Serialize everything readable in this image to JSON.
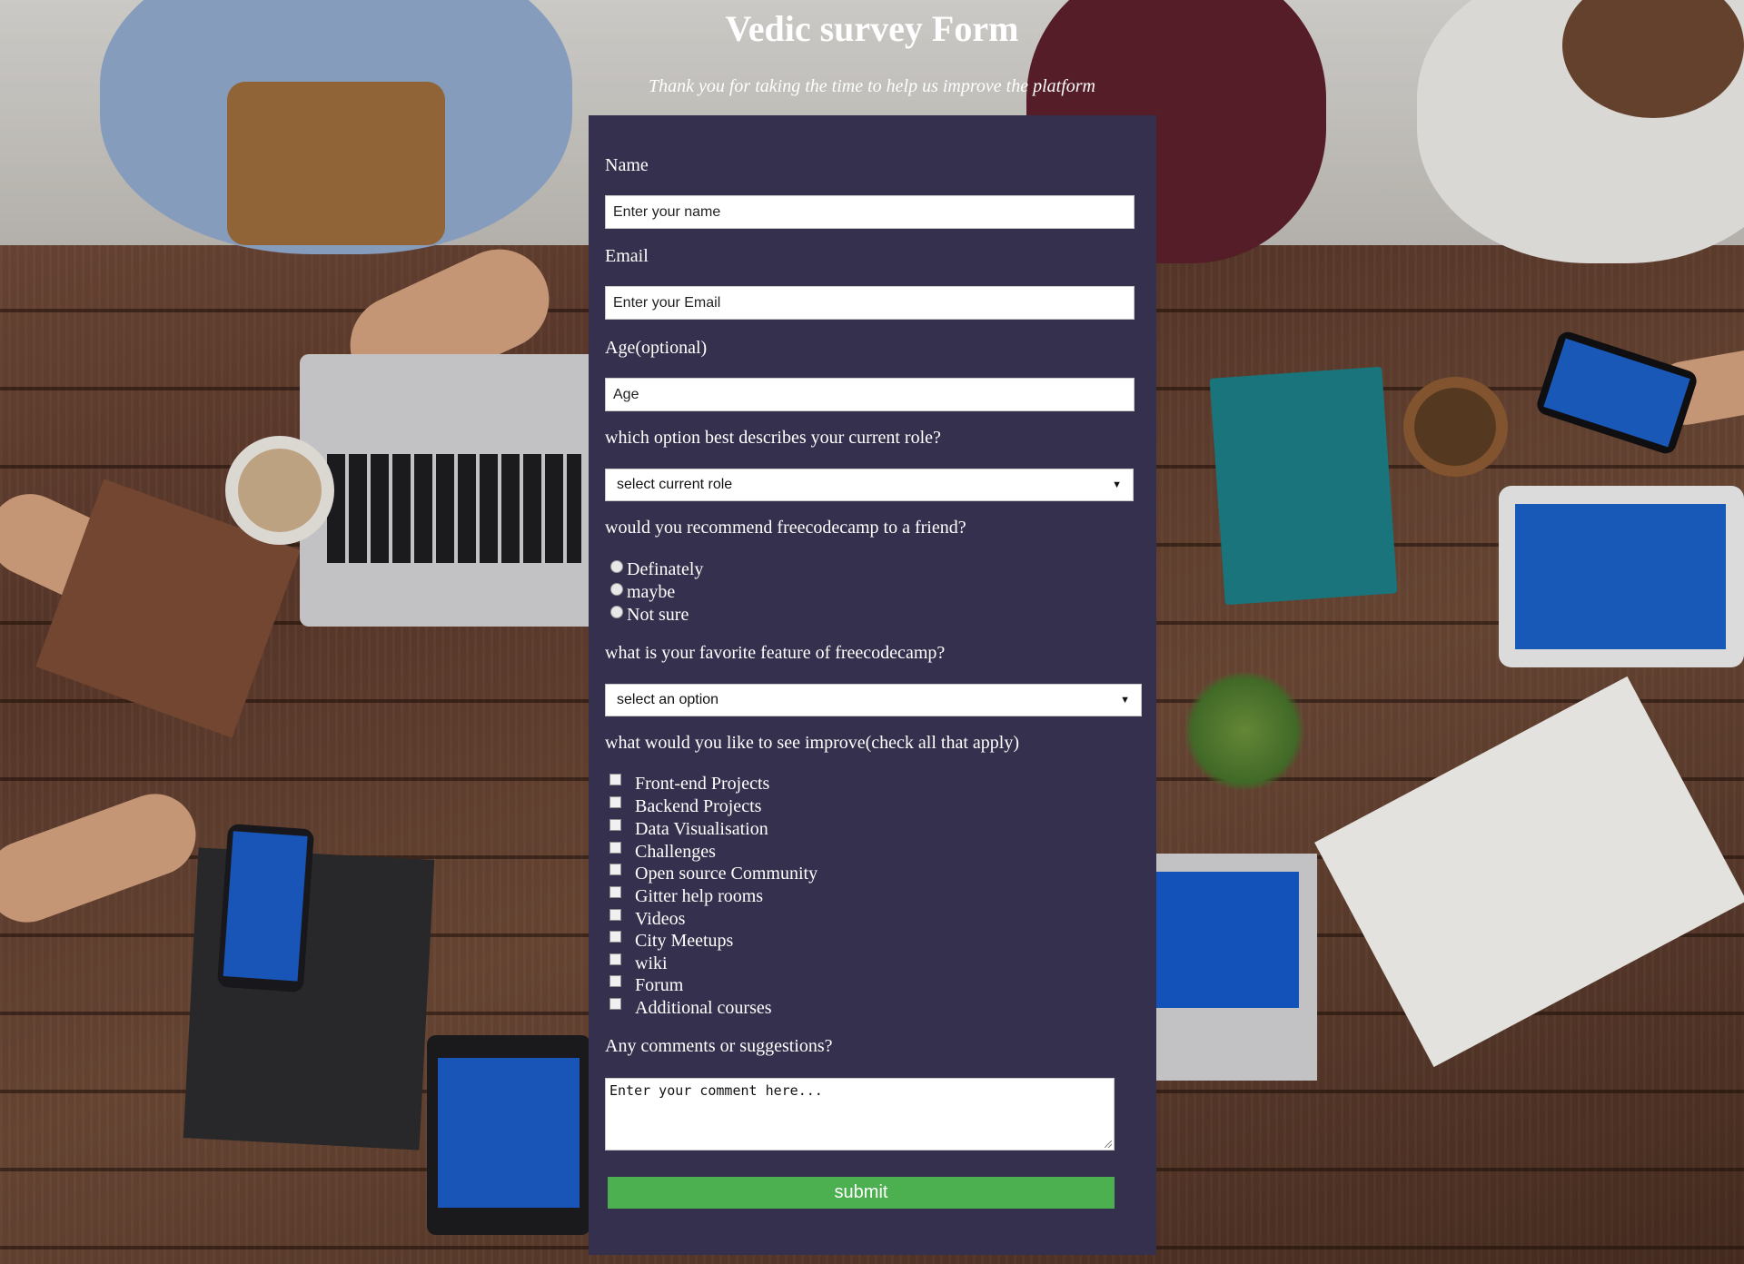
{
  "header": {
    "title": "Vedic survey Form",
    "description": "Thank you for taking the time to help us improve the platform"
  },
  "form": {
    "name": {
      "label": "Name",
      "placeholder": "Enter your name"
    },
    "email": {
      "label": "Email",
      "placeholder": "Enter your Email"
    },
    "age": {
      "label": "Age(optional)",
      "placeholder": "Age"
    },
    "role": {
      "label": "which option best describes your current role?",
      "selected": "select current role"
    },
    "recommend": {
      "label": "would you recommend freecodecamp to a friend?",
      "options": [
        "Definately",
        "maybe",
        "Not sure"
      ]
    },
    "feature": {
      "label": "what is your favorite feature of freecodecamp?",
      "selected": "select an option"
    },
    "improve": {
      "label": "what would you like to see improve(check all that apply)",
      "options": [
        "Front-end Projects",
        "Backend Projects",
        "Data Visualisation",
        "Challenges",
        "Open source Community",
        "Gitter help rooms",
        "Videos",
        "City Meetups",
        "wiki",
        "Forum",
        "Additional courses"
      ]
    },
    "comments": {
      "label": "Any comments or suggestions?",
      "placeholder": "Enter your comment here..."
    },
    "submit_label": "submit"
  },
  "colors": {
    "card_background": "#35304d",
    "submit_background": "#4caf50"
  },
  "icons": {
    "select_caret": "triangle-down-icon"
  }
}
